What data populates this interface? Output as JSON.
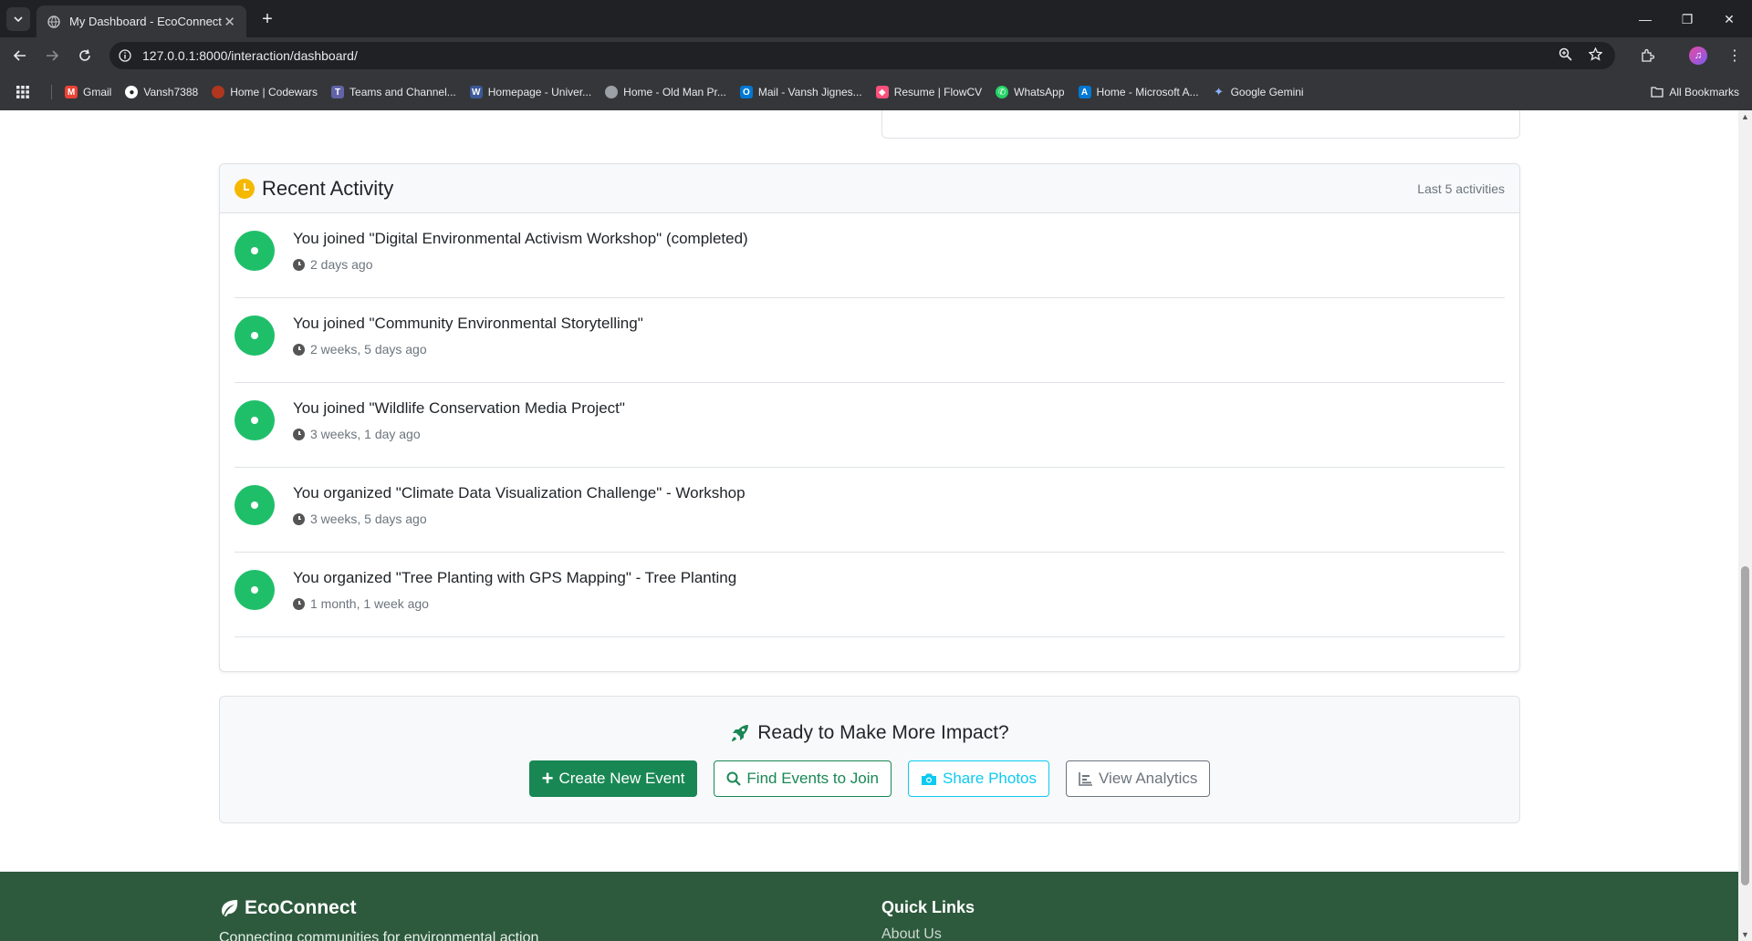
{
  "browser": {
    "tab_title": "My Dashboard - EcoConnect",
    "url": "127.0.0.1:8000/interaction/dashboard/",
    "bookmarks": [
      {
        "label": "Gmail",
        "color": "#ea4335"
      },
      {
        "label": "Vansh7388",
        "color": "#ffffff"
      },
      {
        "label": "Home | Codewars",
        "color": "#b1361e"
      },
      {
        "label": "Teams and Channel...",
        "color": "#6264a7"
      },
      {
        "label": "Homepage - Univer...",
        "color": "#3b5998"
      },
      {
        "label": "Home - Old Man Pr...",
        "color": "#9aa0a6"
      },
      {
        "label": "Mail - Vansh Jignes...",
        "color": "#0078d4"
      },
      {
        "label": "Resume | FlowCV",
        "color": "#ff4f7b"
      },
      {
        "label": "WhatsApp",
        "color": "#25d366"
      },
      {
        "label": "Home - Microsoft A...",
        "color": "#0078d4"
      },
      {
        "label": "Google Gemini",
        "color": "#8ab4f8"
      }
    ],
    "all_bookmarks": "All Bookmarks"
  },
  "activity": {
    "title": "Recent Activity",
    "meta": "Last 5 activities",
    "items": [
      {
        "text": "You joined \"Digital Environmental Activism Workshop\" (completed)",
        "time": "2 days ago"
      },
      {
        "text": "You joined \"Community Environmental Storytelling\"",
        "time": "2 weeks, 5 days ago"
      },
      {
        "text": "You joined \"Wildlife Conservation Media Project\"",
        "time": "3 weeks, 1 day ago"
      },
      {
        "text": "You organized \"Climate Data Visualization Challenge\" - Workshop",
        "time": "3 weeks, 5 days ago"
      },
      {
        "text": "You organized \"Tree Planting with GPS Mapping\" - Tree Planting",
        "time": "1 month, 1 week ago"
      }
    ]
  },
  "cta": {
    "title": "Ready to Make More Impact?",
    "buttons": {
      "create": "Create New Event",
      "find": "Find Events to Join",
      "share": "Share Photos",
      "analytics": "View Analytics"
    }
  },
  "footer": {
    "brand": "EcoConnect",
    "tagline": "Connecting communities for environmental action",
    "quick_links_title": "Quick Links",
    "quick_links": [
      "About Us"
    ]
  },
  "colors": {
    "accent_green": "#198754",
    "activity_dot": "#1fbf6a",
    "footer_bg": "#2d5a3d",
    "info": "#0dcaf0"
  }
}
